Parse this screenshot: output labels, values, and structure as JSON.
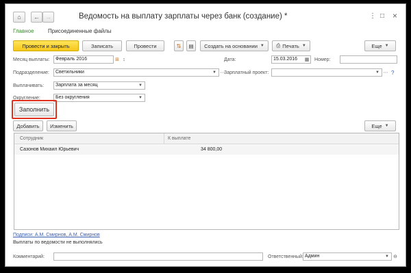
{
  "window": {
    "title": "Ведомость на выплату зарплаты через банк (создание) *",
    "home_glyph": "⌂",
    "back_glyph": "←",
    "forward_glyph": "→",
    "star_glyph": "☆",
    "menu_glyph": "⋮",
    "maximize_glyph": "□",
    "close_glyph": "×"
  },
  "tabs": {
    "main": "Главное",
    "files": "Присоединенные файлы"
  },
  "toolbar": {
    "post_close": "Провести и закрыть",
    "save": "Записать",
    "post": "Провести",
    "create_based": "Создать на основании",
    "print": "Печать",
    "more": "Еще"
  },
  "form": {
    "month_label": "Месяц выплаты:",
    "month_value": "Февраль 2016",
    "date_label": "Дата:",
    "date_value": "15.03.2016",
    "number_label": "Номер:",
    "number_value": "",
    "dept_label": "Подразделение:",
    "dept_value": "Светильники",
    "project_label": "Зарплатный проект:",
    "project_value": "",
    "pay_label": "Выплачивать:",
    "pay_value": "Зарплата за месяц",
    "round_label": "Округление:",
    "round_value": "Без округления",
    "help": "?"
  },
  "fill_button": "Заполнить",
  "table_toolbar": {
    "add": "Добавить",
    "edit": "Изменить",
    "more": "Еще"
  },
  "table": {
    "headers": [
      "Сотрудник",
      "К выплате"
    ],
    "rows": [
      {
        "employee": "Сазонов Михаил Юрьевич",
        "amount": "34 800,00"
      }
    ]
  },
  "footer": {
    "signatures": "Подписи: А.М. Смирнов, А.М. Смирнов",
    "status": "Выплаты по ведомости не выполнялись",
    "comment_label": "Комментарий:",
    "comment_value": "",
    "responsible_label": "Ответственный:",
    "responsible_value": "Админ"
  },
  "colors": {
    "primary_button": "#f5c71a",
    "link_green": "#3b8a2e",
    "highlight": "#e0301e",
    "link_blue": "#3a5fb0"
  }
}
